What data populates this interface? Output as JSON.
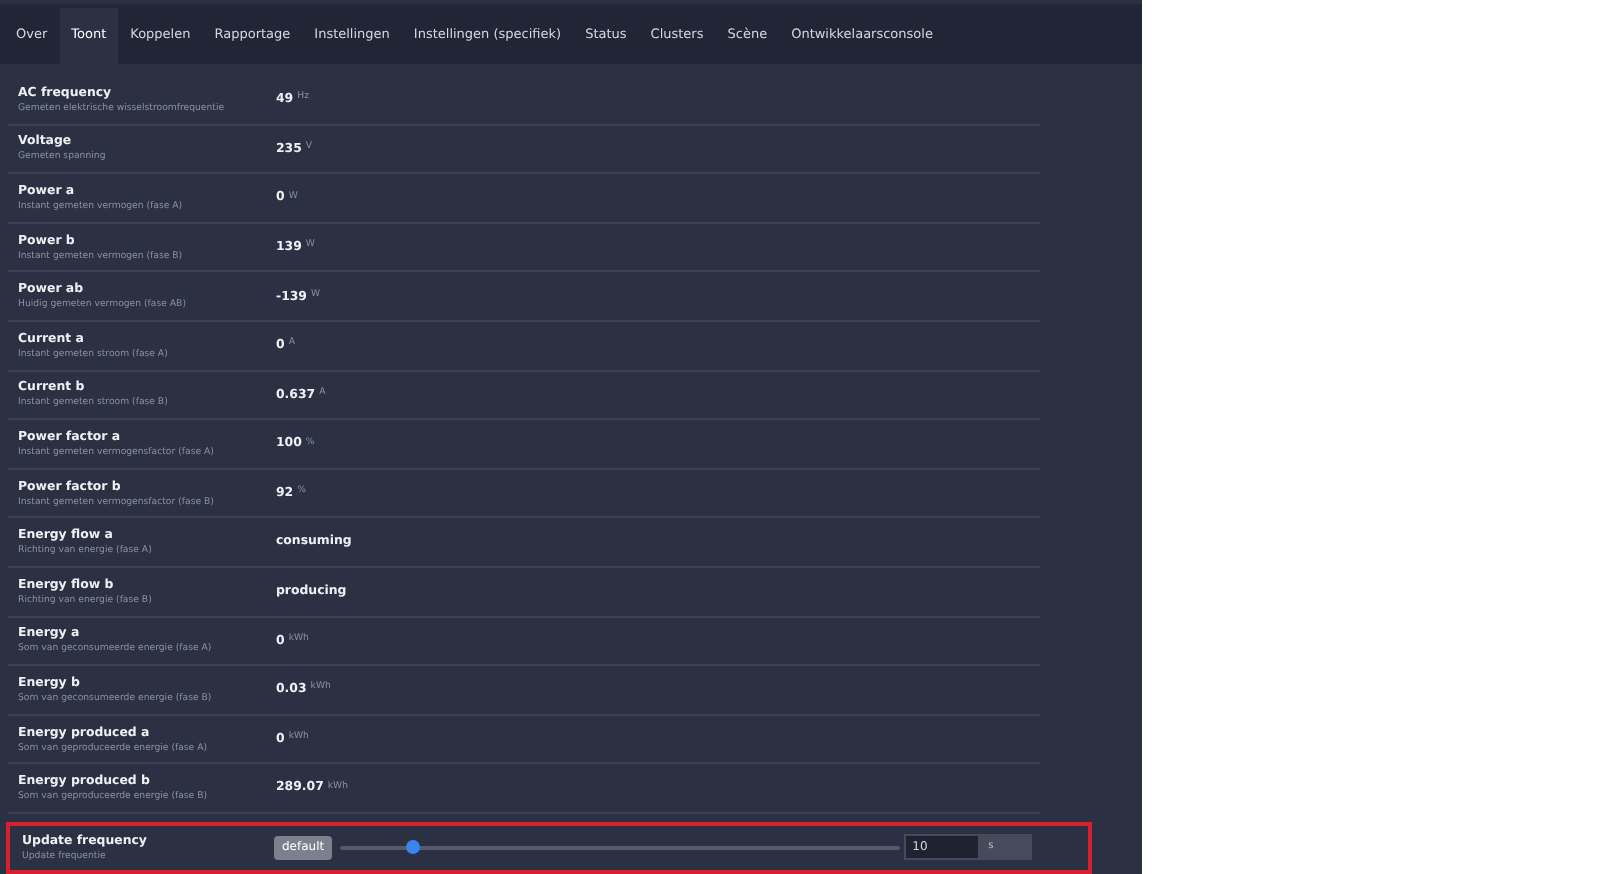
{
  "tabs": [
    {
      "label": "Over",
      "selected": false
    },
    {
      "label": "Toont",
      "selected": true
    },
    {
      "label": "Koppelen",
      "selected": false
    },
    {
      "label": "Rapportage",
      "selected": false
    },
    {
      "label": "Instellingen",
      "selected": false
    },
    {
      "label": "Instellingen (specifiek)",
      "selected": false
    },
    {
      "label": "Status",
      "selected": false
    },
    {
      "label": "Clusters",
      "selected": false
    },
    {
      "label": "Scène",
      "selected": false
    },
    {
      "label": "Ontwikkelaarsconsole",
      "selected": false
    }
  ],
  "rows": [
    {
      "name": "AC frequency",
      "description": "Gemeten elektrische wisselstroomfrequentie",
      "value": "49",
      "unit": "Hz"
    },
    {
      "name": "Voltage",
      "description": "Gemeten spanning",
      "value": "235",
      "unit": "V"
    },
    {
      "name": "Power a",
      "description": "Instant gemeten vermogen (fase A)",
      "value": "0",
      "unit": "W"
    },
    {
      "name": "Power b",
      "description": "Instant gemeten vermogen (fase B)",
      "value": "139",
      "unit": "W"
    },
    {
      "name": "Power ab",
      "description": "Huidig gemeten vermogen (fase AB)",
      "value": "-139",
      "unit": "W"
    },
    {
      "name": "Current a",
      "description": "Instant gemeten stroom (fase A)",
      "value": "0",
      "unit": "A"
    },
    {
      "name": "Current b",
      "description": "Instant gemeten stroom (fase B)",
      "value": "0.637",
      "unit": "A"
    },
    {
      "name": "Power factor a",
      "description": "Instant gemeten vermogensfactor (fase A)",
      "value": "100",
      "unit": "%"
    },
    {
      "name": "Power factor b",
      "description": "Instant gemeten vermogensfactor (fase B)",
      "value": "92",
      "unit": "%"
    },
    {
      "name": "Energy flow a",
      "description": "Richting van energie (fase A)",
      "value": "consuming"
    },
    {
      "name": "Energy flow b",
      "description": "Richting van energie (fase B)",
      "value": "producing"
    },
    {
      "name": "Energy a",
      "description": "Som van geconsumeerde energie (fase A)",
      "value": "0",
      "unit": "kWh"
    },
    {
      "name": "Energy b",
      "description": "Som van geconsumeerde energie (fase B)",
      "value": "0.03",
      "unit": "kWh"
    },
    {
      "name": "Energy produced a",
      "description": "Som van geproduceerde energie (fase A)",
      "value": "0",
      "unit": "kWh"
    },
    {
      "name": "Energy produced b",
      "description": "Som van geproduceerde energie (fase B)",
      "value": "289.07",
      "unit": "kWh"
    }
  ],
  "update_frequency": {
    "name": "Update frequency",
    "description": "Update frequentie",
    "default_button": "default",
    "level": 0.13,
    "value": "10",
    "unit": "s"
  }
}
